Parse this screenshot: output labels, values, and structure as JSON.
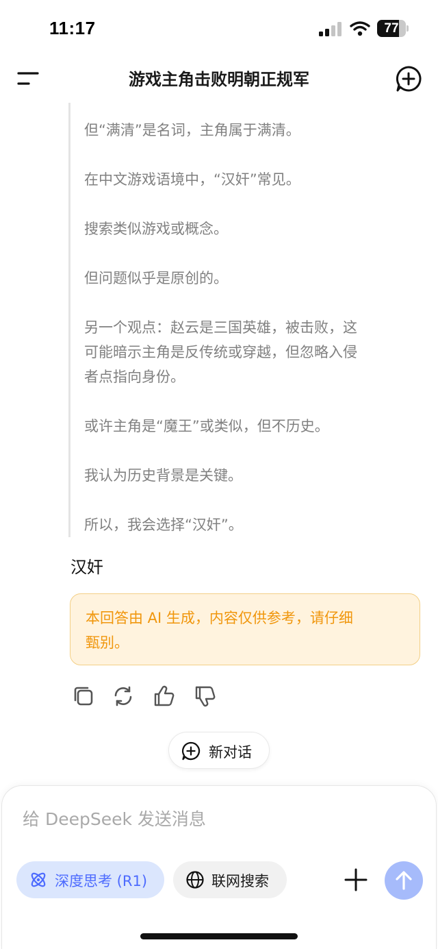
{
  "status_bar": {
    "time": "11:17",
    "battery_level": "77",
    "battery_percent": 77
  },
  "header": {
    "title": "游戏主角击败明朝正规军"
  },
  "thinking": {
    "lines": [
      "但“满清”是名词，主角属于满清。",
      "在中文游戏语境中，“汉奸”常见。",
      "搜索类似游戏或概念。",
      "但问题似乎是原创的。",
      "另一个观点：赵云是三国英雄，被击败，这",
      "可能暗示主角是反传统或穿越，但忽略入侵",
      "者点指向身份。",
      "或许主角是“魔王”或类似，但不历史。",
      "我认为历史背景是关键。",
      "所以，我会选择“汉奸”。"
    ]
  },
  "answer": {
    "text": "汉奸"
  },
  "notice": {
    "line1": "本回答由 AI 生成，内容仅供参考，请仔细",
    "line2": "甄别。"
  },
  "new_dialog": {
    "label": "新对话"
  },
  "composer": {
    "placeholder": "给 DeepSeek 发送消息",
    "deep_think_label": "深度思考 (R1)",
    "web_search_label": "联网搜索"
  },
  "colors": {
    "accent": "#4d6bfe",
    "accent_bg": "#dbe6fd",
    "notice_text": "#f0960c",
    "notice_bg": "#fff3de",
    "send_disabled": "#a6bbfb"
  },
  "icons": {
    "menu": "menu-icon",
    "new_chat": "plus-circle-icon",
    "copy": "copy-icon",
    "regenerate": "refresh-icon",
    "like": "thumbs-up-icon",
    "dislike": "thumbs-down-icon",
    "deep_think": "atom-icon",
    "web_search": "globe-icon",
    "attach": "plus-icon",
    "send": "arrow-up-icon"
  }
}
